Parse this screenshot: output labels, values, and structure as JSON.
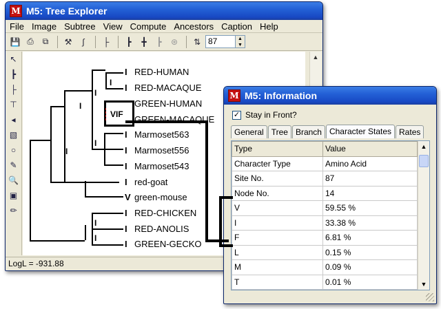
{
  "tree_window": {
    "title": "M5: Tree Explorer",
    "menu": [
      "File",
      "Image",
      "Subtree",
      "View",
      "Compute",
      "Ancestors",
      "Caption",
      "Help"
    ],
    "toolbar_value": "87",
    "status": "LogL = -931.88",
    "taxa": [
      {
        "state": "I",
        "name": "RED-HUMAN"
      },
      {
        "state": "I",
        "name": "RED-MACAQUE"
      },
      {
        "state": "V",
        "name": "GREEN-HUMAN"
      },
      {
        "state": "F",
        "name": "GREEN-MACAQUE"
      },
      {
        "state": "I",
        "name": "Marmoset563"
      },
      {
        "state": "I",
        "name": "Marmoset556"
      },
      {
        "state": "I",
        "name": "Marmoset543"
      },
      {
        "state": "I",
        "name": "red-goat"
      },
      {
        "state": "V",
        "name": "green-mouse"
      },
      {
        "state": "I",
        "name": "RED-CHICKEN"
      },
      {
        "state": "I",
        "name": "RED-ANOLIS"
      },
      {
        "state": "I",
        "name": "GREEN-GECKO"
      }
    ],
    "node_labels": {
      "primate_red": "I",
      "primate_green": "VIF",
      "primates": "I",
      "marmoset": "I",
      "mammals": "I",
      "reptiles": "I",
      "reptiles_inner": "I"
    }
  },
  "info_window": {
    "title": "M5: Information",
    "stay_in_front_label": "Stay in Front?",
    "stay_in_front_checked": true,
    "tabs": [
      "General",
      "Tree",
      "Branch",
      "Character States",
      "Rates"
    ],
    "active_tab": "Character States",
    "grid_header": [
      "Type",
      "Value"
    ],
    "grid_rows": [
      [
        "Character Type",
        "Amino Acid"
      ],
      [
        "Site No.",
        "87"
      ],
      [
        "Node No.",
        "14"
      ],
      [
        "V",
        "59.55 %"
      ],
      [
        "I",
        "33.38 %"
      ],
      [
        "F",
        "6.81 %"
      ],
      [
        "L",
        "0.15 %"
      ],
      [
        "M",
        "0.09 %"
      ],
      [
        "T",
        "0.01 %"
      ]
    ]
  },
  "colors": {
    "titlebar": "#2360d6",
    "window_face": "#ece9d8",
    "app_logo": "#c41010"
  }
}
